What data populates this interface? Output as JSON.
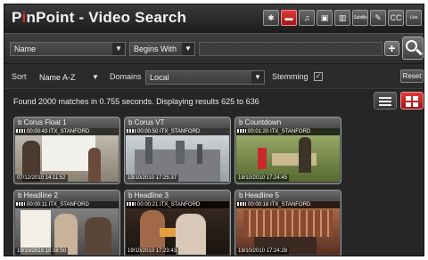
{
  "app": {
    "title_pre": "P",
    "title_dot": "i",
    "title_post": "nPoint - Video Search"
  },
  "toolbar": {
    "icons": [
      {
        "name": "sparkle-icon",
        "glyph": "✱",
        "active": false
      },
      {
        "name": "video-icon",
        "glyph": "▬",
        "active": true
      },
      {
        "name": "music-icon",
        "glyph": "♫",
        "active": false
      },
      {
        "name": "image-icon",
        "glyph": "▣",
        "active": false
      },
      {
        "name": "film-strip-icon",
        "glyph": "▥",
        "active": false
      },
      {
        "name": "subtitle-icon",
        "glyph": "Subtitle",
        "active": false
      },
      {
        "name": "pencil-icon",
        "glyph": "✎",
        "active": false
      },
      {
        "name": "closed-caption-icon",
        "glyph": "CC",
        "active": false
      },
      {
        "name": "live-icon",
        "glyph": "Live",
        "active": false
      }
    ]
  },
  "search": {
    "field_value": "Name",
    "operator_value": "Begins With",
    "query_value": "",
    "plus_label": "+"
  },
  "filters": {
    "sort_label": "Sort",
    "sort_value": "Name A-Z",
    "domains_label": "Domains",
    "domains_value": "Local",
    "stemming_label": "Stemming",
    "stemming_mark": "✓",
    "reset_label": "Reset"
  },
  "status": {
    "text": "Found 2000 matches in 0.755 seconds. Displaying results 625 to 636"
  },
  "results": [
    {
      "title": "b Corus Float 1",
      "timecode": "00:00:43 ITX_STANFORD",
      "date": "07/12/2010 14:11:52"
    },
    {
      "title": "b Corus VT",
      "timecode": "00:00:50 ITX_STANFORD",
      "date": "19/10/2010 17:25:37"
    },
    {
      "title": "b Countdown",
      "timecode": "00:01:20 ITX_STANFORD",
      "date": "19/10/2010 17:24:45"
    },
    {
      "title": "b Headline 2",
      "timecode": "00:00:11 ITX_STANFORD",
      "date": "19/10/2010 10:38:50"
    },
    {
      "title": "b Headline 3",
      "timecode": "00:00:21 ITX_STANFORD",
      "date": "19/10/2010 17:23:43"
    },
    {
      "title": "b Headline 5",
      "timecode": "00:00:18 ITX_STANFORD",
      "date": "19/10/2010 17:24:28"
    }
  ]
}
